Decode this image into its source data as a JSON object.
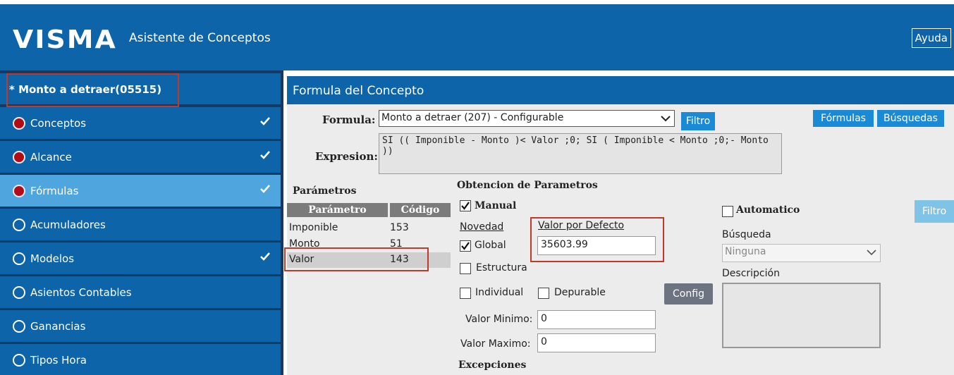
{
  "header": {
    "logo": "VISMA",
    "title": "Asistente de Conceptos",
    "help_label": "Ayuda"
  },
  "sidebar": {
    "current": "* Monto a detraer(05515)",
    "items": [
      {
        "label": "Conceptos",
        "done": true,
        "filled": true
      },
      {
        "label": "Alcance",
        "done": true,
        "filled": true
      },
      {
        "label": "Fórmulas",
        "done": true,
        "filled": true,
        "active": true
      },
      {
        "label": "Acumuladores",
        "done": false,
        "filled": false
      },
      {
        "label": "Modelos",
        "done": true,
        "filled": false
      },
      {
        "label": "Asientos Contables",
        "done": false,
        "filled": false
      },
      {
        "label": "Ganancias",
        "done": false,
        "filled": false
      },
      {
        "label": "Tipos Hora",
        "done": false,
        "filled": false
      }
    ]
  },
  "main": {
    "title": "Formula del Concepto",
    "formula_label": "Formula:",
    "formula_value": "Monto a detraer (207) - Configurable",
    "filter_label": "Filtro",
    "formulas_btn": "Fórmulas",
    "searches_btn": "Búsquedas",
    "expression_label": "Expresion:",
    "expression_value": "SI (( Imponible - Monto )< Valor ;0; SI ( Imponible < Monto ;0;- Monto ))",
    "params_title": "Parámetros",
    "params_headers": {
      "param": "Parámetro",
      "code": "Código"
    },
    "params_rows": [
      {
        "name": "Imponible",
        "code": "153"
      },
      {
        "name": "Monto",
        "code": "51"
      },
      {
        "name": "Valor",
        "code": "143"
      }
    ],
    "obtain_title": "Obtencion de Parametros",
    "manual_label": "Manual",
    "manual_checked": true,
    "novedad_label": "Novedad",
    "default_value_label": "Valor por Defecto",
    "default_value": "35603.99",
    "global_label": "Global",
    "global_checked": true,
    "estructura_label": "Estructura",
    "individual_label": "Individual",
    "depurable_label": "Depurable",
    "config_label": "Config",
    "min_label": "Valor Minimo:",
    "min_value": "0",
    "max_label": "Valor Maximo:",
    "max_value": "0",
    "exceptions_label": "Excepciones",
    "automatic_label": "Automatico",
    "automatic_checked": false,
    "filter2_label": "Filtro",
    "search_label": "Búsqueda",
    "search_value": "Ninguna",
    "description_label": "Descripción"
  }
}
